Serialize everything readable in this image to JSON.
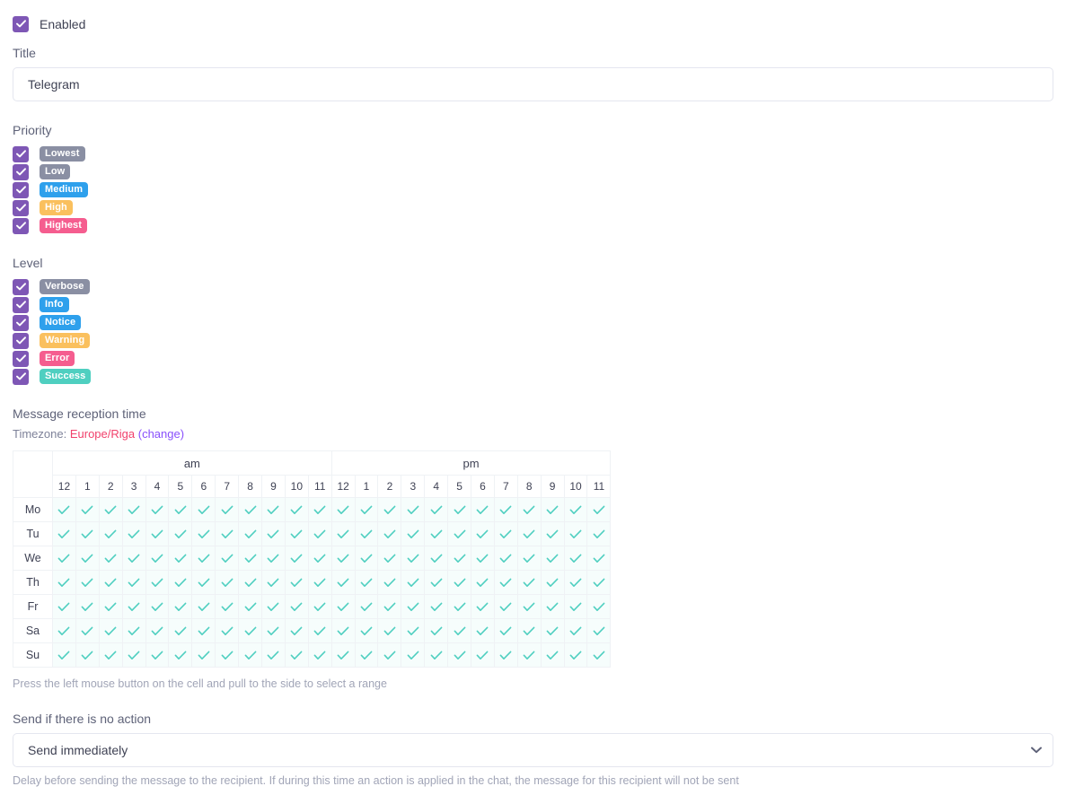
{
  "enabled": {
    "label": "Enabled",
    "checked": true
  },
  "title_field": {
    "label": "Title",
    "value": "Telegram",
    "placeholder": ""
  },
  "priority": {
    "label": "Priority",
    "items": [
      {
        "label": "Lowest",
        "color": "#8a8fa3",
        "checked": true
      },
      {
        "label": "Low",
        "color": "#8a8fa3",
        "checked": true
      },
      {
        "label": "Medium",
        "color": "#2ea0ec",
        "checked": true
      },
      {
        "label": "High",
        "color": "#fac05e",
        "checked": true
      },
      {
        "label": "Highest",
        "color": "#f55d8f",
        "checked": true
      }
    ]
  },
  "level": {
    "label": "Level",
    "items": [
      {
        "label": "Verbose",
        "color": "#8a8fa3",
        "checked": true
      },
      {
        "label": "Info",
        "color": "#2ea0ec",
        "checked": true
      },
      {
        "label": "Notice",
        "color": "#2ea0ec",
        "checked": true
      },
      {
        "label": "Warning",
        "color": "#fac05e",
        "checked": true
      },
      {
        "label": "Error",
        "color": "#f55d8f",
        "checked": true
      },
      {
        "label": "Success",
        "color": "#4fcfc0",
        "checked": true
      }
    ]
  },
  "reception": {
    "title": "Message reception time",
    "timezone_prefix": "Timezone:",
    "timezone_value": "Europe/Riga",
    "timezone_change": "(change)",
    "am_label": "am",
    "pm_label": "pm",
    "hours_am": [
      "12",
      "1",
      "2",
      "3",
      "4",
      "5",
      "6",
      "7",
      "8",
      "9",
      "10",
      "11"
    ],
    "hours_pm": [
      "12",
      "1",
      "2",
      "3",
      "4",
      "5",
      "6",
      "7",
      "8",
      "9",
      "10",
      "11"
    ],
    "days": [
      "Mo",
      "Tu",
      "We",
      "Th",
      "Fr",
      "Sa",
      "Su"
    ],
    "all_selected": true,
    "hint": "Press the left mouse button on the cell and pull to the side to select a range",
    "check_color": "#4fcfc0",
    "cell_bg": "#f6fdfc"
  },
  "no_action": {
    "label": "Send if there is no action",
    "selected": "Send immediately",
    "options": [
      "Send immediately"
    ],
    "footnote": "Delay before sending the message to the recipient. If during this time an action is applied in the chat, the message for this recipient will not be sent"
  },
  "theme": {
    "checkbox_purple": "#7e57b5",
    "link_pink": "#f1416c",
    "link_purple": "#8950fc",
    "border": "#e4e6ef"
  }
}
